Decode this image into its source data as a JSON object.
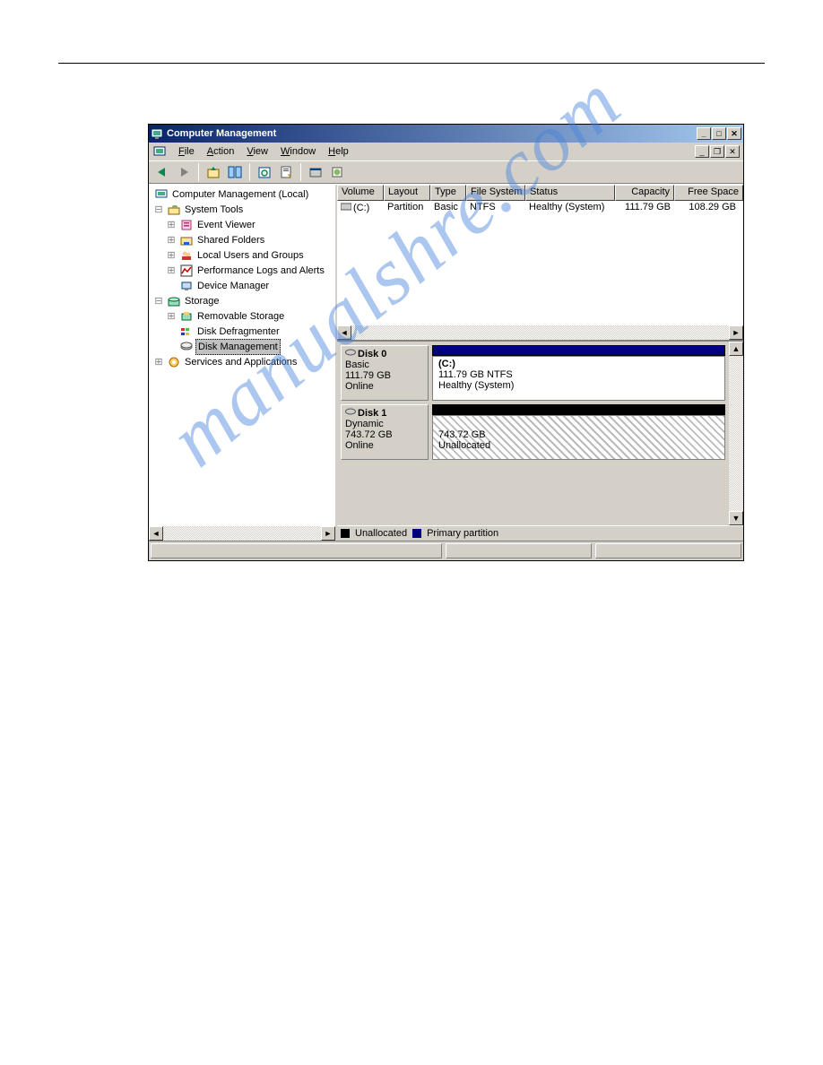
{
  "window": {
    "title": "Computer Management"
  },
  "menu": {
    "file": "File",
    "action": "Action",
    "view": "View",
    "window": "Window",
    "help": "Help"
  },
  "tree": {
    "root": "Computer Management (Local)",
    "systools": "System Tools",
    "eventviewer": "Event Viewer",
    "sharedfolders": "Shared Folders",
    "localusers": "Local Users and Groups",
    "perflogs": "Performance Logs and Alerts",
    "devmgr": "Device Manager",
    "storage": "Storage",
    "remstorage": "Removable Storage",
    "defrag": "Disk Defragmenter",
    "diskmgmt": "Disk Management",
    "services": "Services and Applications"
  },
  "list": {
    "headers": {
      "volume": "Volume",
      "layout": "Layout",
      "type": "Type",
      "filesystem": "File System",
      "status": "Status",
      "capacity": "Capacity",
      "freespace": "Free Space"
    },
    "row0": {
      "volume": "(C:)",
      "layout": "Partition",
      "type": "Basic",
      "filesystem": "NTFS",
      "status": "Healthy (System)",
      "capacity": "111.79 GB",
      "freespace": "108.29 GB"
    }
  },
  "disks": {
    "d0": {
      "name": "Disk 0",
      "type": "Basic",
      "size": "111.79 GB",
      "state": "Online",
      "part": {
        "label": "(C:)",
        "detail": "111.79 GB NTFS",
        "status": "Healthy (System)"
      }
    },
    "d1": {
      "name": "Disk 1",
      "type": "Dynamic",
      "size": "743.72 GB",
      "state": "Online",
      "part": {
        "detail": "743.72 GB",
        "status": "Unallocated"
      }
    }
  },
  "legend": {
    "unalloc": "Unallocated",
    "primary": "Primary partition"
  },
  "watermark": "manualshre.com"
}
